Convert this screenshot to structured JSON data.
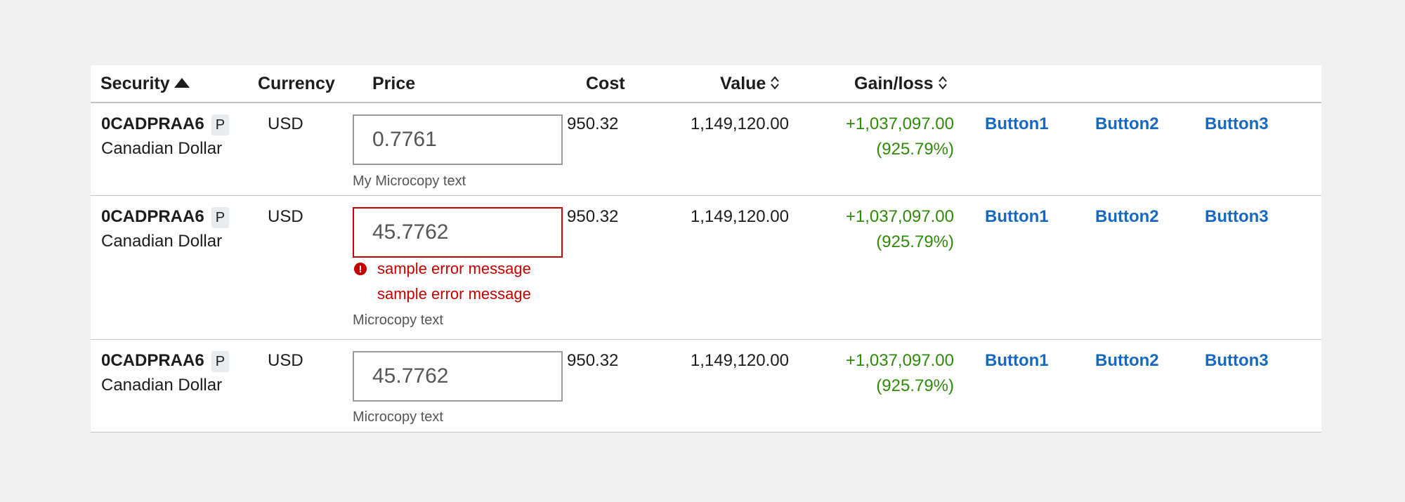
{
  "table": {
    "headers": {
      "security": "Security",
      "currency": "Currency",
      "price": "Price",
      "cost": "Cost",
      "value": "Value",
      "gain_loss": "Gain/loss"
    },
    "rows": [
      {
        "symbol": "0CADPRAA6",
        "badge": "P",
        "description": "Canadian Dollar",
        "currency": "USD",
        "price": "0.7761",
        "microcopy": "My Microcopy text",
        "errors": [],
        "cost": "950.32",
        "value": "1,149,120.00",
        "gain": "+1,037,097.00",
        "gain_pct": "(925.79%)",
        "buttons": [
          "Button1",
          "Button2",
          "Button3"
        ]
      },
      {
        "symbol": "0CADPRAA6",
        "badge": "P",
        "description": "Canadian Dollar",
        "currency": "USD",
        "price": "45.7762",
        "microcopy": "Microcopy text",
        "errors": [
          "sample error message",
          "sample error message"
        ],
        "cost": "950.32",
        "value": "1,149,120.00",
        "gain": "+1,037,097.00",
        "gain_pct": "(925.79%)",
        "buttons": [
          "Button1",
          "Button2",
          "Button3"
        ]
      },
      {
        "symbol": "0CADPRAA6",
        "badge": "P",
        "description": "Canadian Dollar",
        "currency": "USD",
        "price": "45.7762",
        "microcopy": "Microcopy text",
        "errors": [],
        "cost": "950.32",
        "value": "1,149,120.00",
        "gain": "+1,037,097.00",
        "gain_pct": "(925.79%)",
        "buttons": [
          "Button1",
          "Button2",
          "Button3"
        ]
      }
    ]
  },
  "icons": {
    "sort_ascending": "sort-ascending-icon",
    "sort_unsorted": "sort-unsorted-icon",
    "error": "error-icon"
  },
  "colors": {
    "gain": "#2f8a0a",
    "link": "#1668c1",
    "error": "#c40000"
  }
}
